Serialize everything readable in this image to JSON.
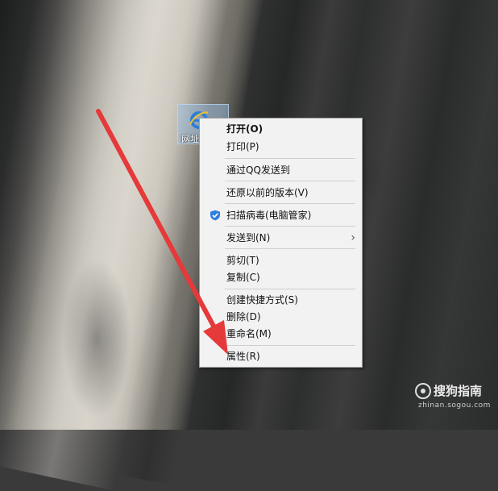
{
  "desktop_icon": {
    "label": "网址"
  },
  "context_menu": {
    "items": [
      {
        "label": "打开(O)",
        "bold": true
      },
      {
        "label": "打印(P)"
      },
      {
        "label": "通过QQ发送到"
      },
      {
        "label": "还原以前的版本(V)"
      },
      {
        "label": "扫描病毒(电脑管家)",
        "icon": "shield-icon"
      },
      {
        "label": "发送到(N)",
        "submenu": true
      },
      {
        "label": "剪切(T)"
      },
      {
        "label": "复制(C)"
      },
      {
        "label": "创建快捷方式(S)"
      },
      {
        "label": "删除(D)"
      },
      {
        "label": "重命名(M)"
      },
      {
        "label": "属性(R)"
      }
    ]
  },
  "watermark": {
    "brand": "搜狗指南",
    "domain": "zhinan.sogou.com"
  },
  "colors": {
    "arrow": "#e5393a",
    "menu_bg": "#f2f2f2",
    "shield": "#2f7fe0"
  }
}
